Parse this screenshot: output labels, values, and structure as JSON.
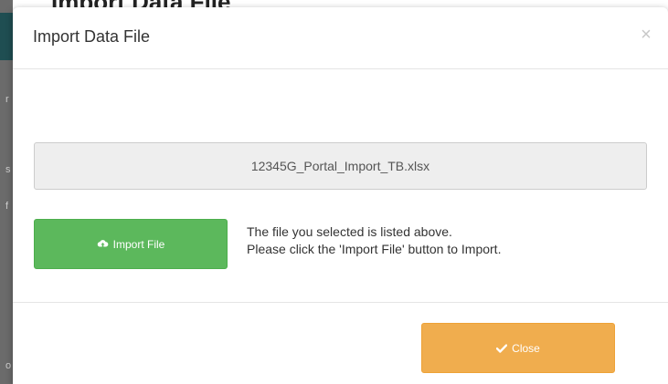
{
  "background": {
    "top_fragment": "Import Data File",
    "left_fragments": [
      "r",
      "s",
      "f",
      "o"
    ]
  },
  "modal": {
    "title": "Import Data File",
    "close_symbol": "×",
    "close_icon": "close-icon",
    "selected_file": "12345G_Portal_Import_TB.xlsx",
    "import_button": {
      "label": "Import File",
      "icon": "cloud-upload-icon",
      "color": "#5cb85c"
    },
    "instructions": [
      "The file you selected is listed above.",
      "Please click the 'Import File' button to Import."
    ],
    "close_button": {
      "label": "Close",
      "icon": "checkmark-icon",
      "color": "#f0ad4e"
    }
  }
}
